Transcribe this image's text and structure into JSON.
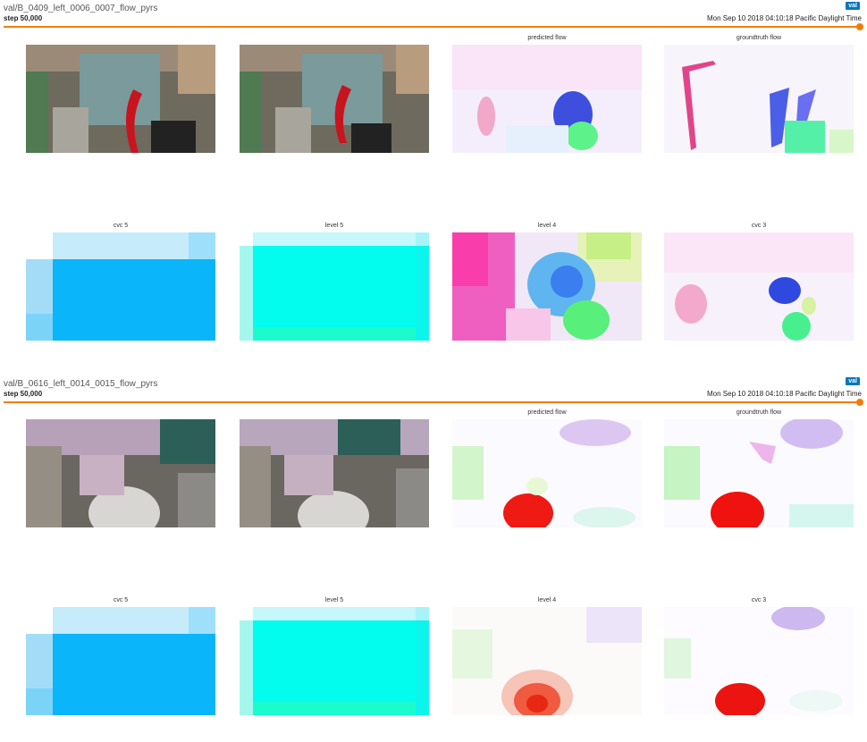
{
  "cards": [
    {
      "title": "val/B_0409_left_0006_0007_flow_pyrs",
      "step": "step 50,000",
      "timestamp": "Mon Sep 10 2018 04:10:18 Pacific Daylight Time",
      "run_chip": "val",
      "accent_color": "#f57c00",
      "panels": [
        "",
        "",
        "predicted flow",
        "groundtruth flow",
        "cvc 5",
        "level 5",
        "level 4",
        "cvc 3"
      ]
    },
    {
      "title": "val/B_0616_left_0014_0015_flow_pyrs",
      "step": "step 50,000",
      "timestamp": "Mon Sep 10 2018 04:10:18 Pacific Daylight Time",
      "run_chip": "val",
      "accent_color": "#f57c00",
      "panels": [
        "",
        "",
        "predicted flow",
        "groundtruth flow",
        "cvc 5",
        "level 5",
        "level 4",
        "cvc 3"
      ]
    }
  ]
}
